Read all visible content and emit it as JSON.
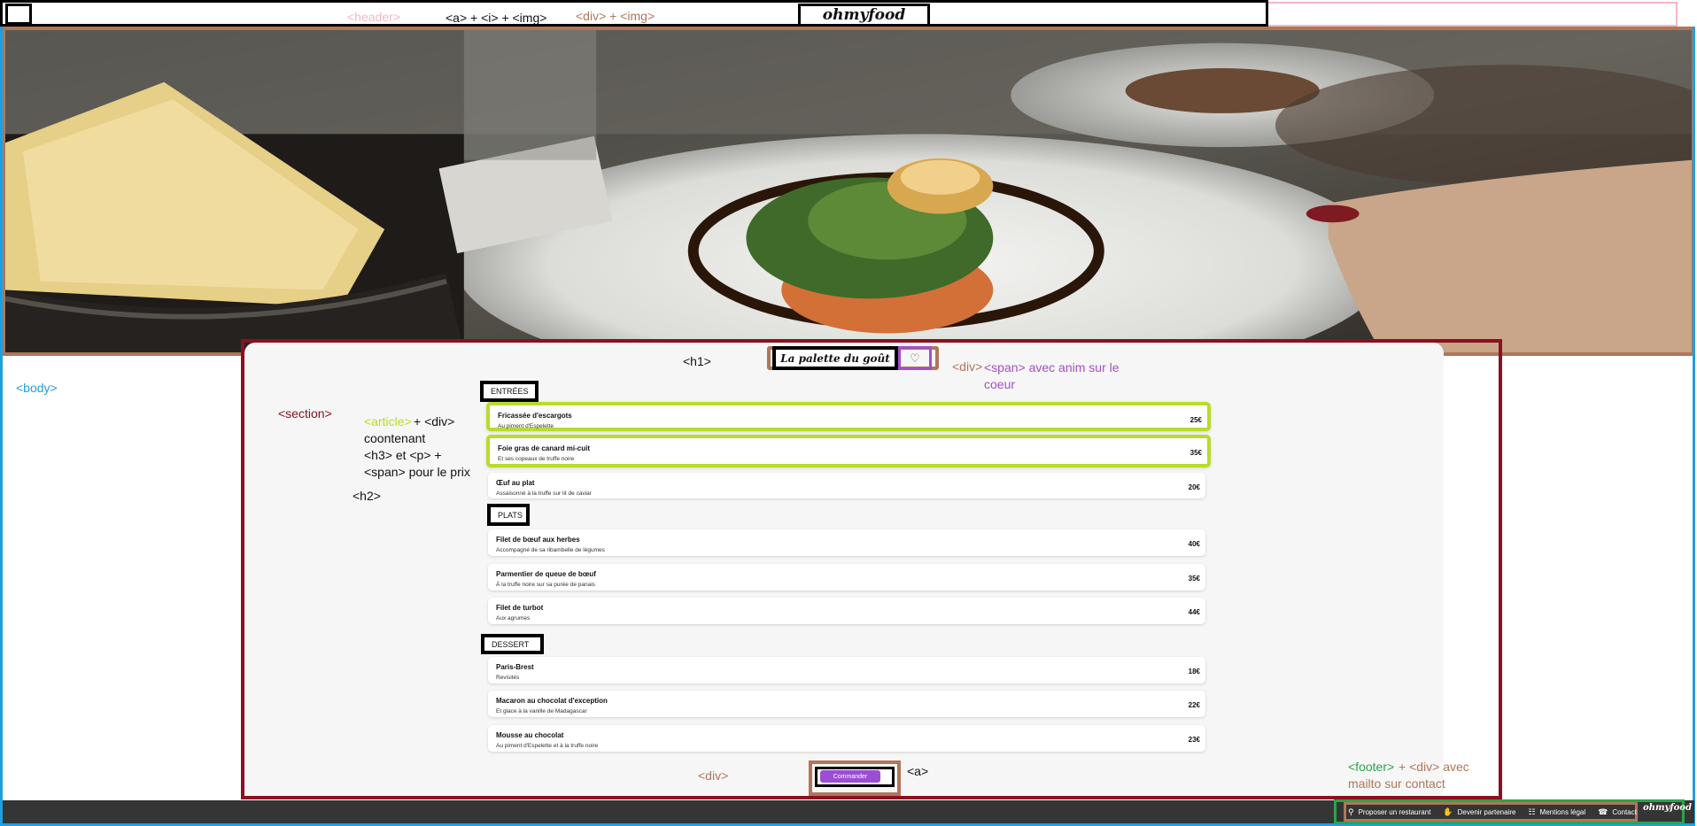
{
  "header": {
    "logo": "ohmyfood",
    "annotation_header": "<header>",
    "annotation_back": "<a> + <i> + <img>",
    "annotation_logo": "<div> + <img>"
  },
  "restaurant": {
    "title": "La palette du goût",
    "heart_icon": "heart-icon"
  },
  "menu": {
    "categories": [
      {
        "title": "ENTRÉES",
        "dishes": [
          {
            "name": "Fricassée d'escargots",
            "description": "Au piment d'Espelette",
            "price": "25€"
          },
          {
            "name": "Foie gras de canard mi-cuit",
            "description": "Et ses copeaux de truffe noire",
            "price": "35€"
          },
          {
            "name": "Œuf au plat",
            "description": "Assaisonné à la truffe sur lit de caviar",
            "price": "20€"
          }
        ]
      },
      {
        "title": "PLATS",
        "dishes": [
          {
            "name": "Filet de bœuf aux herbes",
            "description": "Accompagné de sa ribambelle de légumes",
            "price": "40€"
          },
          {
            "name": "Parmentier de queue de bœuf",
            "description": "À la truffe noire sur sa purée de panais",
            "price": "35€"
          },
          {
            "name": "Filet de turbot",
            "description": "Aux agrumes",
            "price": "44€"
          }
        ]
      },
      {
        "title": "DESSERT",
        "dishes": [
          {
            "name": "Paris-Brest",
            "description": "Revisités",
            "price": "18€"
          },
          {
            "name": "Macaron au chocolat d'exception",
            "description": "Et glace à la vanille de Madagascar",
            "price": "22€"
          },
          {
            "name": "Mousse au chocolat",
            "description": "Au piment d'Espelette et à la truffe noire",
            "price": "23€"
          }
        ]
      }
    ],
    "order_button": "Commander"
  },
  "footer": {
    "links": [
      {
        "label": "Proposer un restaurant",
        "icon": "utensils-icon"
      },
      {
        "label": "Devenir partenaire",
        "icon": "handshake-icon"
      },
      {
        "label": "Mentions légal",
        "icon": "info-icon"
      },
      {
        "label": "Contact",
        "icon": "phone-icon"
      }
    ],
    "logo": "ohmyfood"
  },
  "annotations": {
    "body": "<body>",
    "section": "<section>",
    "article_1": "<article>",
    "article_2": " + <div>",
    "article_3": "coontenant",
    "article_4": "<h3> et <p> +",
    "article_5": "<span> pour le prix",
    "h2": "<h2>",
    "h1": "<h1>",
    "heart_div": "<div>",
    "heart_span_1": "<span> avec anim sur le",
    "heart_span_2": "coeur",
    "order_div": "<div>",
    "order_a": "<a>",
    "footer_1": "<footer>",
    "footer_2": " + <div> avec",
    "footer_3": "mailto sur contact"
  },
  "colors": {
    "annotation_pink": "#f3b8c6",
    "annotation_orange": "#b0765a",
    "annotation_purple": "#a44fc4",
    "annotation_green_light": "#b8dc2b",
    "annotation_green": "#28a54a",
    "annotation_red": "#8b1020",
    "annotation_blue": "#1ea0e0",
    "button_purple": "#9b4dd4",
    "footer_bg": "#353535"
  }
}
